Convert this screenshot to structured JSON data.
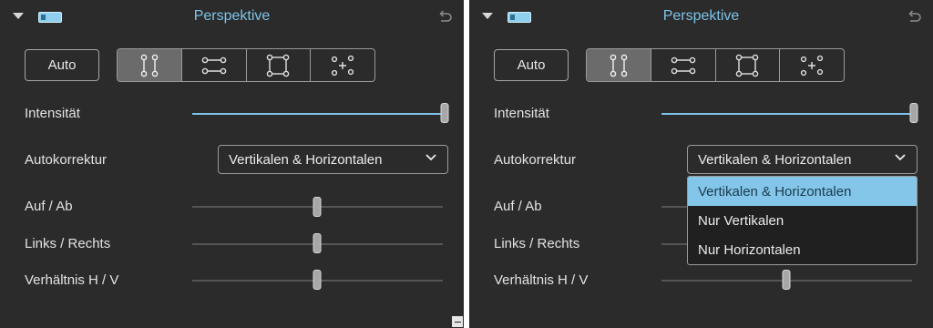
{
  "panels": [
    {
      "title": "Perspektive",
      "auto_label": "Auto",
      "modes": [
        "vertical-mode-icon",
        "horizontal-mode-icon",
        "full-mode-icon",
        "guided-mode-icon"
      ],
      "active_mode": 0,
      "intensity": {
        "label": "Intensität",
        "value": 1.0
      },
      "autocorrection": {
        "label": "Autokorrektur",
        "selected": "Vertikalen & Horizontalen",
        "open": false
      },
      "sliders": [
        {
          "label": "Auf / Ab",
          "value": 0.5
        },
        {
          "label": "Links / Rechts",
          "value": 0.5
        },
        {
          "label": "Verhältnis H / V",
          "value": 0.5
        }
      ],
      "show_minimize": true
    },
    {
      "title": "Perspektive",
      "auto_label": "Auto",
      "modes": [
        "vertical-mode-icon",
        "horizontal-mode-icon",
        "full-mode-icon",
        "guided-mode-icon"
      ],
      "active_mode": 0,
      "intensity": {
        "label": "Intensität",
        "value": 1.0
      },
      "autocorrection": {
        "label": "Autokorrektur",
        "selected": "Vertikalen & Horizontalen",
        "open": true
      },
      "sliders": [
        {
          "label": "Auf / Ab",
          "value": 0.5
        },
        {
          "label": "Links / Rechts",
          "value": 0.5
        },
        {
          "label": "Verhältnis H / V",
          "value": 0.5
        }
      ],
      "dropdown_options": [
        "Vertikalen & Horizontalen",
        "Nur Vertikalen",
        "Nur Horizontalen"
      ],
      "show_minimize": false
    }
  ],
  "colors": {
    "accent": "#7dc4ea",
    "panel_bg": "#2b2b2b",
    "selected_option_bg": "#83c6e9"
  }
}
